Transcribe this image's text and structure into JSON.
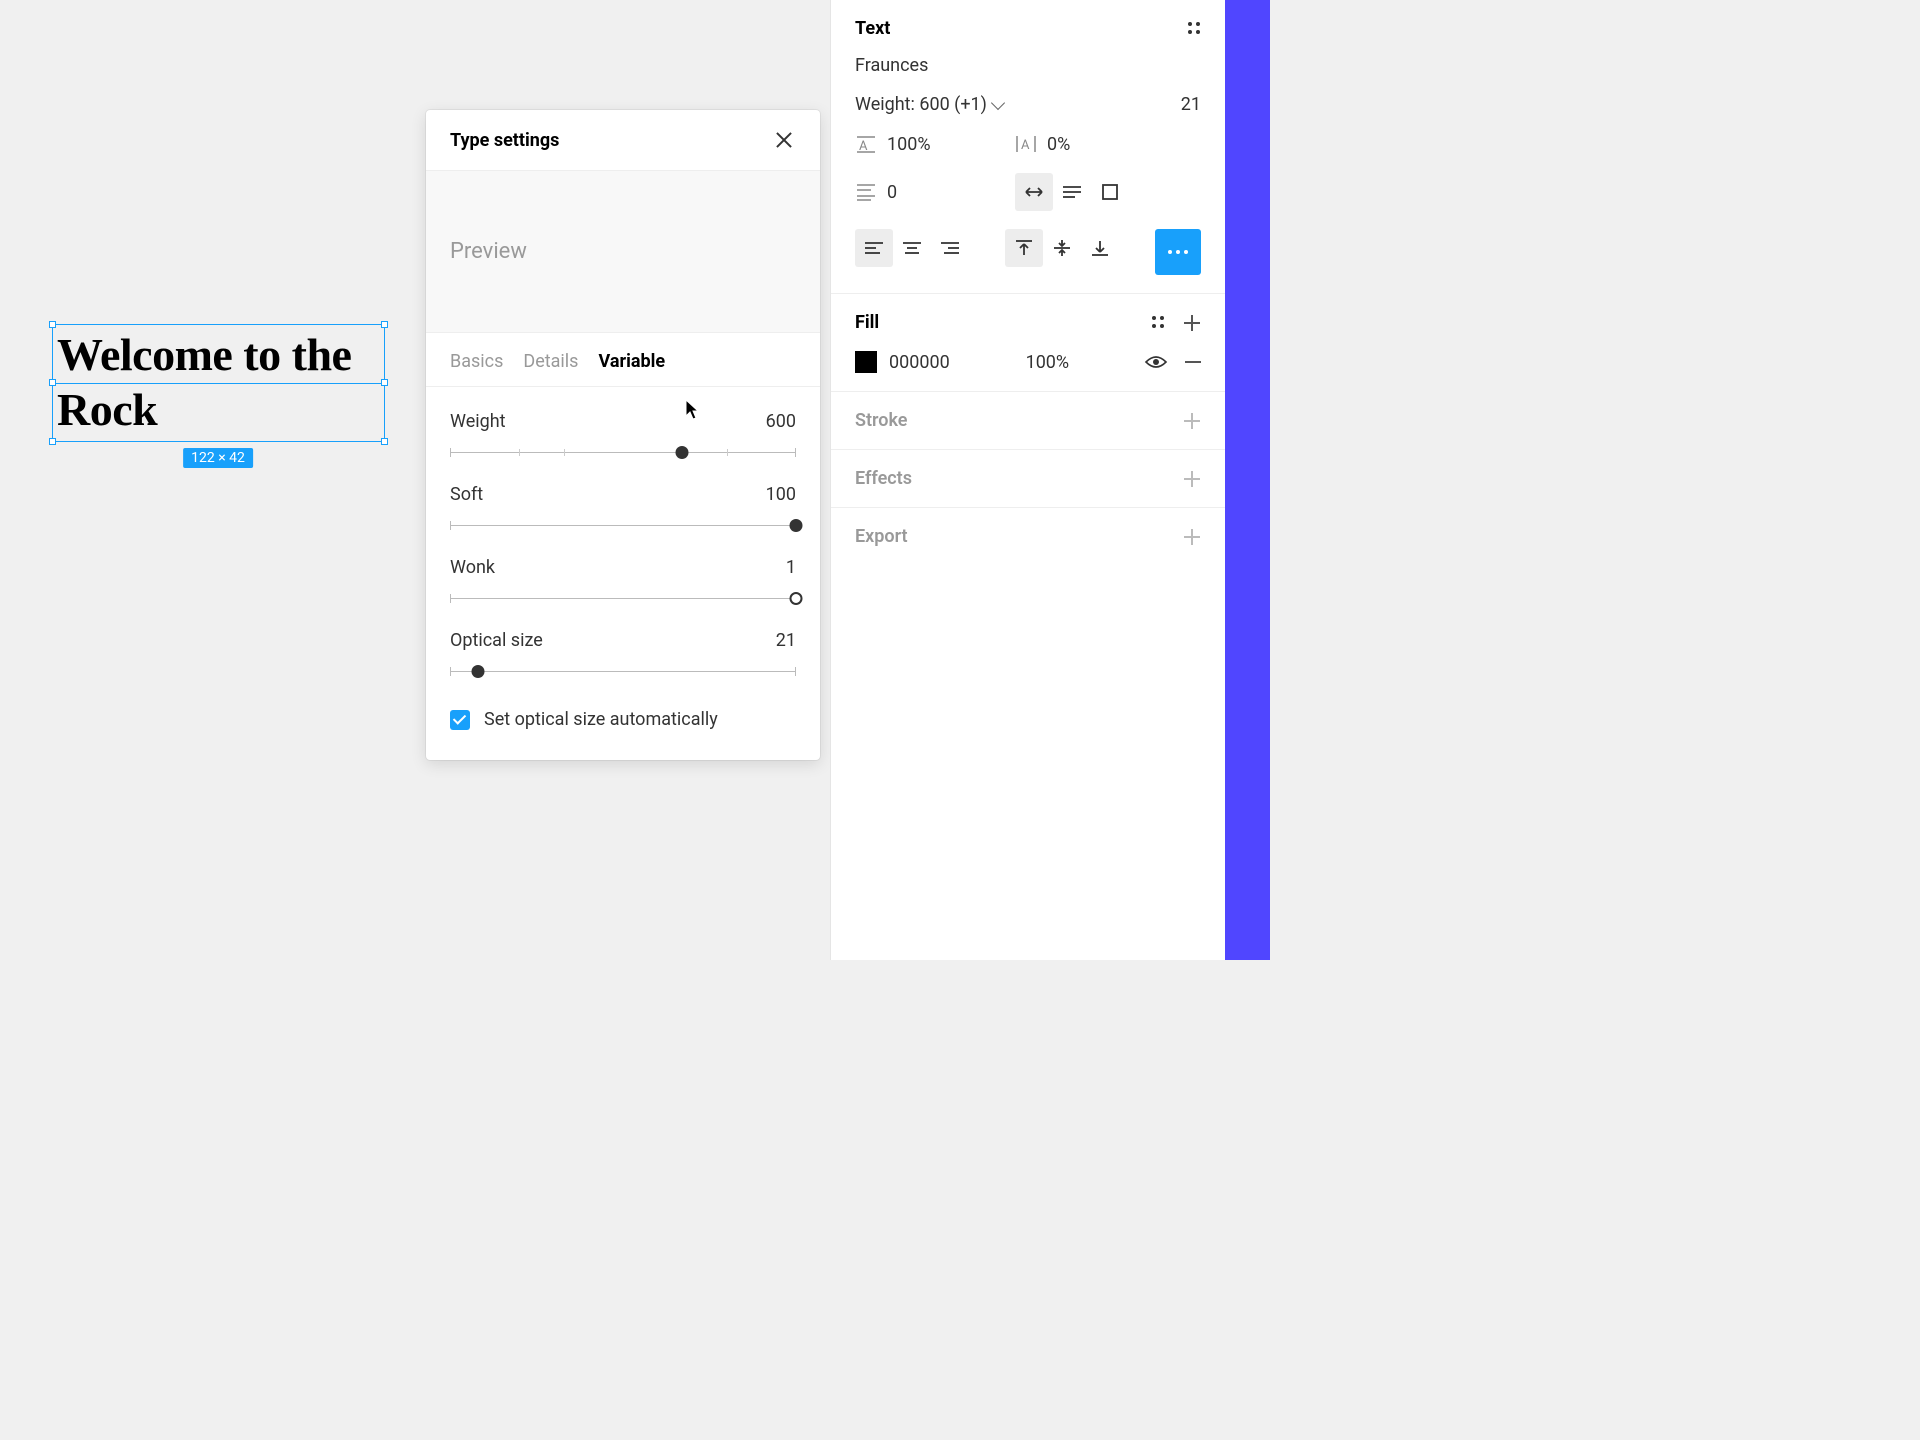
{
  "canvas": {
    "text_content": "Welcome to the Rock",
    "dimensions_badge": "122 × 42"
  },
  "popover": {
    "title": "Type settings",
    "preview_label": "Preview",
    "tabs": {
      "basics": "Basics",
      "details": "Details",
      "variable": "Variable"
    },
    "axes": {
      "weight": {
        "label": "Weight",
        "value": "600",
        "percent": 67
      },
      "soft": {
        "label": "Soft",
        "value": "100",
        "percent": 100
      },
      "wonk": {
        "label": "Wonk",
        "value": "1",
        "percent": 100
      },
      "optical": {
        "label": "Optical size",
        "value": "21",
        "percent": 8
      }
    },
    "checkbox_label": "Set optical size automatically"
  },
  "inspector": {
    "text": {
      "heading": "Text",
      "font_family": "Fraunces",
      "weight_label": "Weight: 600 (+1)",
      "font_size": "21",
      "line_height": "100%",
      "letter_spacing": "0%",
      "paragraph_spacing": "0"
    },
    "fill": {
      "heading": "Fill",
      "hex": "000000",
      "opacity": "100%"
    },
    "stroke_heading": "Stroke",
    "effects_heading": "Effects",
    "export_heading": "Export"
  }
}
